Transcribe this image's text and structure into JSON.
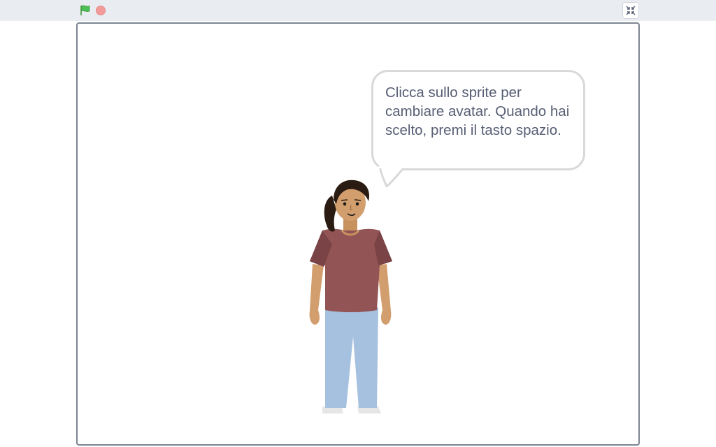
{
  "toolbar": {
    "green_flag_icon": "green-flag-icon",
    "stop_icon": "stop-icon",
    "fullscreen_icon": "exit-fullscreen-icon"
  },
  "stage": {
    "speech_bubble": {
      "text": "Clicca sullo sprite per cambiare avatar. Quando hai scelto, premi il tasto spazio."
    },
    "sprite": {
      "description_icon": "avatar-girl-sprite"
    }
  },
  "colors": {
    "flag_green": "#4cbf56",
    "stop_red": "#f29b9b",
    "shirt": "#935455",
    "shirt_sleeve": "#7a4447",
    "pants": "#a6c0df",
    "skin": "#d29e6e",
    "hair": "#2a1c12",
    "bubble_text": "#575e75"
  }
}
